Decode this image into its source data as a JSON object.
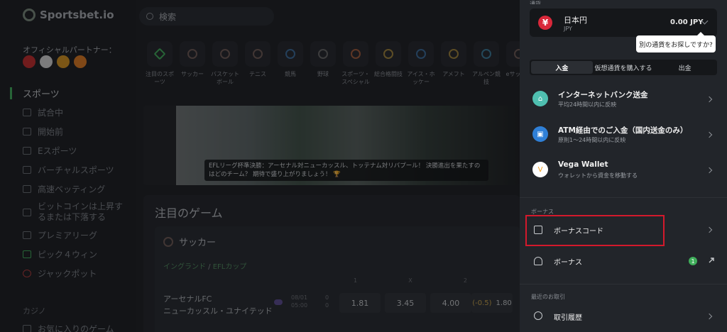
{
  "app": {
    "logo_text": "Sportsbet.io",
    "partner_label": "オフィシャルパートナー：",
    "search_placeholder": "検索"
  },
  "sidebar": {
    "items": [
      {
        "label": "スポーツ",
        "icon": "sports-icon"
      },
      {
        "label": "試合中",
        "icon": "live-icon"
      },
      {
        "label": "開始前",
        "icon": "calendar-icon"
      },
      {
        "label": "Eスポーツ",
        "icon": "esports-icon"
      },
      {
        "label": "バーチャルスポーツ",
        "icon": "virtual-icon"
      },
      {
        "label": "高速ベッティング",
        "icon": "fast-bet-icon"
      },
      {
        "label": "ビットコインは上昇するまたは下落する",
        "icon": "bitcoin-icon"
      },
      {
        "label": "プレミアリーグ",
        "icon": "premier-league-icon"
      },
      {
        "label": "ピック４ウィン",
        "icon": "pick4win-icon"
      },
      {
        "label": "ジャックポット",
        "icon": "jackpot-icon"
      }
    ],
    "casino_label": "カジノ",
    "favorites_label": "お気に入りのゲーム"
  },
  "sports_row": [
    {
      "label": "注目のスポーツ",
      "icon": "star-icon"
    },
    {
      "label": "サッカー",
      "icon": "soccer-icon"
    },
    {
      "label": "バスケットボール",
      "icon": "basketball-icon"
    },
    {
      "label": "テニス",
      "icon": "tennis-icon"
    },
    {
      "label": "競馬",
      "icon": "horse-racing-icon"
    },
    {
      "label": "野球",
      "icon": "baseball-icon"
    },
    {
      "label": "スポーツ・スペシャル",
      "icon": "special-icon"
    },
    {
      "label": "総合格闘技",
      "icon": "mma-icon"
    },
    {
      "label": "アイス・ホッケー",
      "icon": "hockey-icon"
    },
    {
      "label": "アメフト",
      "icon": "football-icon"
    },
    {
      "label": "アルペン競技",
      "icon": "ski-icon"
    },
    {
      "label": "eサッカー",
      "icon": "esoccer-icon"
    }
  ],
  "banner": {
    "caption": "EFLリーグ杯準決勝：アーセナル対ニューカッスル、トッテナム対リバプール！ 決勝進出を果たすのはどのチーム？ 期待で盛り上がりましょう！ 🏆"
  },
  "featured": {
    "title": "注目のゲーム",
    "sport": "サッカー",
    "league_country": "イングランド",
    "league_sep": " / ",
    "league_name": "EFLカップ",
    "col_heads": [
      "1",
      "X",
      "2"
    ],
    "match": {
      "home": "アーセナルFC",
      "away": "ニューカッスル・ユナイテッド",
      "date": "08/01",
      "time": "05:00",
      "score_home": "0",
      "score_away": "0",
      "odds": [
        "1.81",
        "3.45",
        "4.00"
      ],
      "handicap": "(-0.5)",
      "handicap_odds": "1.80"
    }
  },
  "panel": {
    "top_label": "通貨",
    "currency": {
      "name": "日本円",
      "code": "JPY",
      "amount": "0.00 JPY",
      "symbol": "¥"
    },
    "tooltip": "別の通貨をお探しですか?",
    "tabs": [
      {
        "label": "入金",
        "active": true
      },
      {
        "label": "仮想通貨を購入する",
        "active": false
      },
      {
        "label": "出金",
        "active": false
      }
    ],
    "methods": [
      {
        "title": "インターネットバンク送金",
        "sub": "平均24時間以内に反映",
        "color": "#4fbfb0",
        "icon": "bank-icon"
      },
      {
        "title": "ATM経由でのご入金（国内送金のみ）",
        "sub": "原則1～24時間以内に反映",
        "color": "#2f7fd6",
        "icon": "atm-icon"
      },
      {
        "title": "Vega Wallet",
        "sub": "ウォレットから資金を移動する",
        "color": "#f2c230",
        "icon": "vega-wallet-icon"
      }
    ],
    "bonus_section_label": "ボーナス",
    "bonus_code_label": "ボーナスコード",
    "bonus_label": "ボーナス",
    "bonus_count": "1",
    "recent_label": "最近のお取引",
    "history_label": "取引履歴"
  }
}
